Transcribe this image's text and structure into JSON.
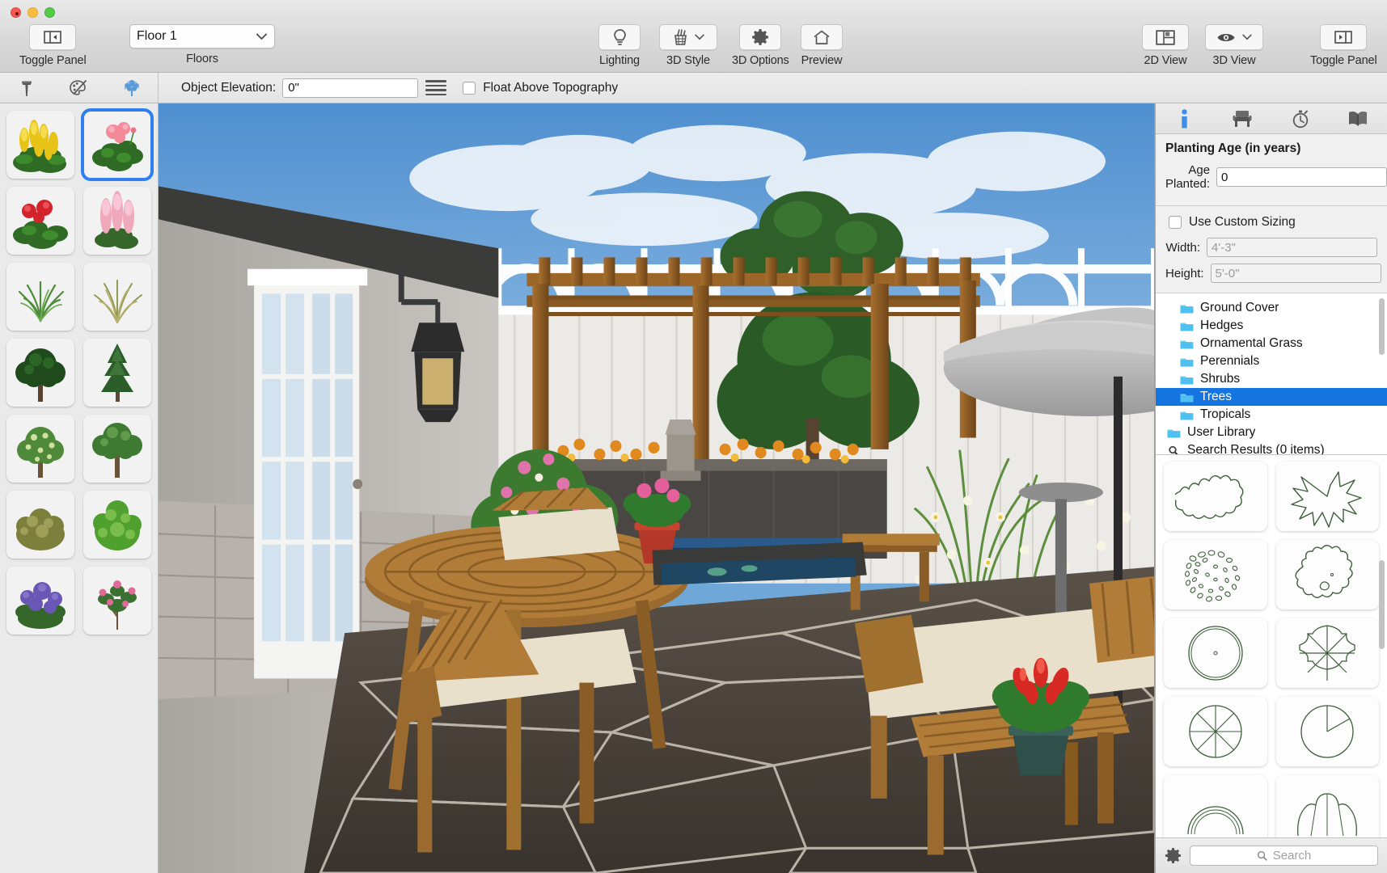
{
  "window": {
    "traffic_lights": [
      "close",
      "minimize",
      "zoom"
    ]
  },
  "toolbar": {
    "toggle_panel_left": {
      "label": "Toggle Panel",
      "icon": "toggle-left-panel-icon"
    },
    "floors": {
      "label": "Floors",
      "value": "Floor 1",
      "icon": "chevron-down-icon"
    },
    "lighting": {
      "label": "Lighting",
      "icon": "lightbulb-icon"
    },
    "style_3d": {
      "label": "3D Style",
      "icon": "paint-bucket-icon",
      "dropdown": "chevron-down-icon"
    },
    "options_3d": {
      "label": "3D Options",
      "icon": "gear-icon"
    },
    "preview": {
      "label": "Preview",
      "icon": "house-icon"
    },
    "view_2d": {
      "label": "2D View",
      "icon": "floorplan-icon"
    },
    "view_3d": {
      "label": "3D View",
      "icon": "eye-icon",
      "dropdown": "chevron-down-icon"
    },
    "toggle_panel_right": {
      "label": "Toggle Panel",
      "icon": "toggle-right-panel-icon"
    }
  },
  "subbar": {
    "mode_icons": [
      "hammer-icon",
      "paint-palette-icon",
      "plant-tree-icon"
    ],
    "object_elevation_label": "Object Elevation:",
    "object_elevation_value": "0\"",
    "list_icon": "list-lines-icon",
    "float_above_topography_label": "Float Above Topography",
    "float_above_topography_checked": false
  },
  "library": {
    "items": [
      {
        "name": "yellow-celosia",
        "kind": "flower-cluster",
        "colors": [
          "#e8c318",
          "#2f6b24"
        ],
        "selected": false
      },
      {
        "name": "pink-geranium",
        "kind": "geranium",
        "colors": [
          "#f4899a",
          "#2f6b24"
        ],
        "selected": true
      },
      {
        "name": "red-geranium",
        "kind": "geranium",
        "colors": [
          "#d4242b",
          "#2f6b24"
        ],
        "selected": false
      },
      {
        "name": "pink-astilbe",
        "kind": "spike-flower",
        "colors": [
          "#f0a8bc",
          "#35662a"
        ],
        "selected": false
      },
      {
        "name": "green-grass-clump",
        "kind": "grass",
        "colors": [
          "#4e8c3c",
          "#6fae50"
        ],
        "selected": false
      },
      {
        "name": "tan-ornamental-grass",
        "kind": "grass",
        "colors": [
          "#b9b06a",
          "#8f9a55"
        ],
        "selected": false
      },
      {
        "name": "dark-broadleaf-tree",
        "kind": "tree",
        "colors": [
          "#1f4a1c",
          "#2e6b28"
        ],
        "selected": false
      },
      {
        "name": "conifer-tree",
        "kind": "conifer",
        "colors": [
          "#2b5d2a",
          "#4a8040"
        ],
        "selected": false
      },
      {
        "name": "flowering-tree",
        "kind": "tree",
        "colors": [
          "#4f8a3a",
          "#cfe0a0"
        ],
        "selected": false
      },
      {
        "name": "shade-tree",
        "kind": "tree",
        "colors": [
          "#3f7a33",
          "#6aa352"
        ],
        "selected": false
      },
      {
        "name": "olive-shrub",
        "kind": "shrub",
        "colors": [
          "#7d7f3d",
          "#a5a55c"
        ],
        "selected": false
      },
      {
        "name": "bright-green-shrub",
        "kind": "shrub",
        "colors": [
          "#4fa02f",
          "#7ec14e"
        ],
        "selected": false
      },
      {
        "name": "purple-hydrangea",
        "kind": "flower-bush",
        "colors": [
          "#6a57b5",
          "#35662a"
        ],
        "selected": false
      },
      {
        "name": "pink-flowering-shrub",
        "kind": "flower-bush",
        "colors": [
          "#e06a97",
          "#3a7030"
        ],
        "selected": false
      }
    ]
  },
  "inspector": {
    "tabs": [
      {
        "name": "info-tab",
        "icon": "info-icon",
        "active": true
      },
      {
        "name": "furniture-tab",
        "icon": "chair-icon",
        "active": false
      },
      {
        "name": "history-tab",
        "icon": "stopwatch-icon",
        "active": false
      },
      {
        "name": "library-tab",
        "icon": "open-book-icon",
        "active": false
      }
    ],
    "planting_age_title": "Planting Age (in years)",
    "age_planted_label": "Age Planted:",
    "age_planted_value": "0",
    "use_custom_sizing_label": "Use Custom Sizing",
    "use_custom_sizing_checked": false,
    "width_label": "Width:",
    "width_value": "4'-3\"",
    "height_label": "Height:",
    "height_value": "5'-0\"",
    "selection_highlight_color": "#1474e0"
  },
  "category_tree": {
    "rows": [
      {
        "label": "Ground Cover",
        "icon": "folder-icon",
        "indent": 1,
        "selected": false
      },
      {
        "label": "Hedges",
        "icon": "folder-icon",
        "indent": 1,
        "selected": false
      },
      {
        "label": "Ornamental Grass",
        "icon": "folder-icon",
        "indent": 1,
        "selected": false
      },
      {
        "label": "Perennials",
        "icon": "folder-icon",
        "indent": 1,
        "selected": false
      },
      {
        "label": "Shrubs",
        "icon": "folder-icon",
        "indent": 1,
        "selected": false
      },
      {
        "label": "Trees",
        "icon": "folder-icon",
        "indent": 1,
        "selected": true
      },
      {
        "label": "Tropicals",
        "icon": "folder-icon",
        "indent": 1,
        "selected": false
      },
      {
        "label": "User Library",
        "icon": "folder-icon",
        "indent": 0,
        "selected": false
      },
      {
        "label": "Search Results (0 items)",
        "icon": "magnifier-icon",
        "indent": 0,
        "selected": false
      }
    ]
  },
  "symbols": {
    "items": [
      {
        "name": "tree-symbol-scalloped-canopy",
        "kind": "scallop"
      },
      {
        "name": "tree-symbol-starburst-palm",
        "kind": "starburst"
      },
      {
        "name": "tree-symbol-stippled-foliage",
        "kind": "stipple"
      },
      {
        "name": "tree-symbol-irregular-outline",
        "kind": "blob"
      },
      {
        "name": "tree-symbol-double-circle",
        "kind": "circle-lines"
      },
      {
        "name": "tree-symbol-segmented-fan",
        "kind": "fan"
      },
      {
        "name": "tree-symbol-spoked-circle",
        "kind": "spokes"
      },
      {
        "name": "tree-symbol-quadrant-circle",
        "kind": "quadrant"
      },
      {
        "name": "tree-symbol-arc-partial",
        "kind": "arc"
      },
      {
        "name": "tree-symbol-ruffled-edge",
        "kind": "ruffle"
      }
    ]
  },
  "footer": {
    "settings_icon": "gear-icon",
    "search_icon": "magnifier-icon",
    "search_placeholder": "Search"
  }
}
